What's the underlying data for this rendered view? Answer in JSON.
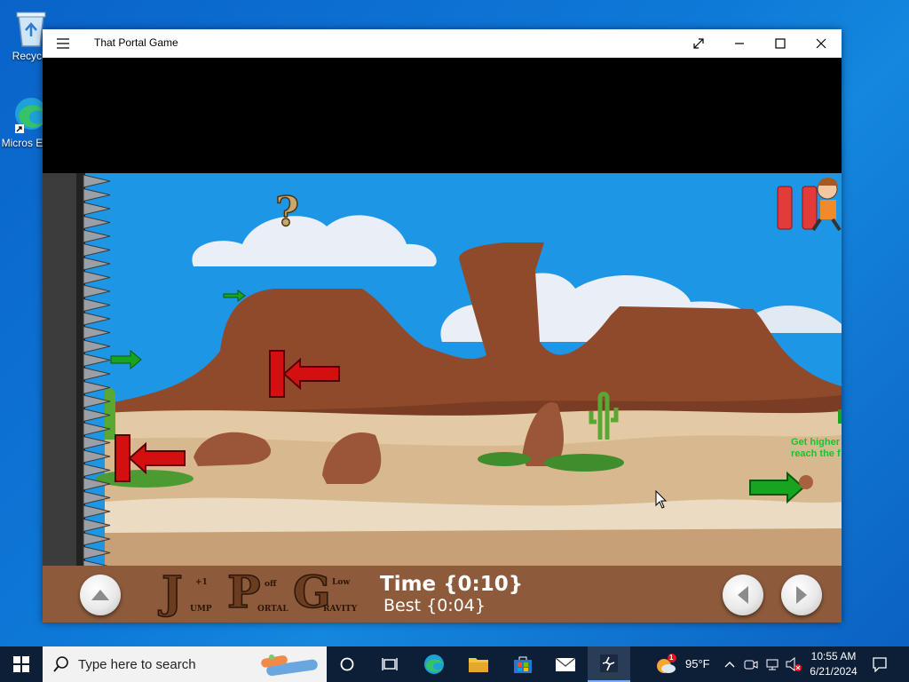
{
  "desktop": {
    "icons": [
      {
        "label": "Recycle",
        "icon": "recycle-bin-icon"
      },
      {
        "label": "Micros Edge",
        "icon": "edge-icon"
      }
    ]
  },
  "window": {
    "title": "That Portal Game",
    "buttons": [
      "menu-icon",
      "fullscreen-icon",
      "minimize-icon",
      "maximize-icon",
      "close-icon"
    ]
  },
  "game": {
    "hint_line1": "Get higher",
    "hint_line2": "reach the f",
    "help_symbol": "?",
    "timer_label": "Time {0:10}",
    "best_label": "Best {0:04}",
    "logo": {
      "j": "J",
      "j_plus": "+1",
      "j_word": "UMP",
      "p": "P",
      "p_word_top": "off",
      "p_word": "ORTAL",
      "g": "G",
      "g_word_top": "Low",
      "g_word": "RAVITY"
    },
    "controls": [
      "jump-up-button",
      "move-left-button",
      "move-right-button"
    ]
  },
  "taskbar": {
    "search_placeholder": "Type here to search",
    "weather_temp": "95°F",
    "weather_badge": "1",
    "time": "10:55 AM",
    "date": "6/21/2024"
  },
  "colors": {
    "sky": "#1e96e6",
    "sand": "#e3c9a4",
    "hud": "#8d5a3b",
    "red_arrow": "#d40f0f",
    "green_arrow": "#17a51f"
  }
}
